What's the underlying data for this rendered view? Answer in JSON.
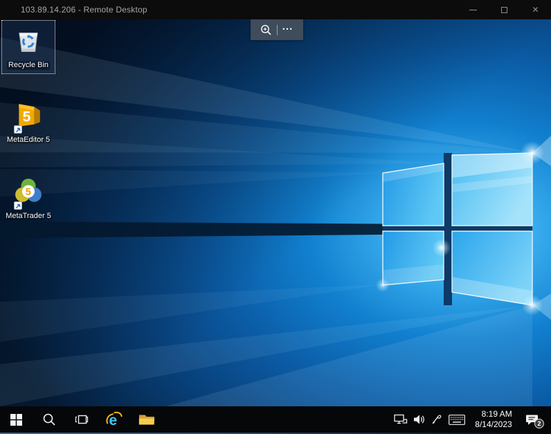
{
  "titlebar": {
    "title": "103.89.14.206 - Remote Desktop",
    "close_glyph": "✕"
  },
  "connection_bar": {
    "zoom_icon": "magnifier-plus-icon",
    "ellipsis": "•••"
  },
  "desktop": {
    "icons": [
      {
        "label": "Recycle Bin",
        "selected": true
      },
      {
        "label": "MetaEditor 5",
        "selected": false
      },
      {
        "label": "MetaTrader 5",
        "selected": false
      }
    ]
  },
  "icons": {
    "metaeditor_glyph": "5",
    "metatrader_glyph": "5",
    "ie_glyph": "e"
  },
  "taskbar": {
    "buttons": [
      "start",
      "search",
      "task-view",
      "internet-explorer",
      "file-explorer"
    ],
    "tray": {
      "time": "8:19 AM",
      "date": "8/14/2023",
      "badge": "2"
    }
  },
  "palette": {
    "taskbar": "#060709",
    "titlebar": "#0c0c0c",
    "title-text": "#a8a8a8",
    "conn-bar": "#3e4c5c",
    "wallpaper-deep": "#051a33",
    "pane-blue": "#2ba4ec",
    "gold": "#f2a900"
  }
}
